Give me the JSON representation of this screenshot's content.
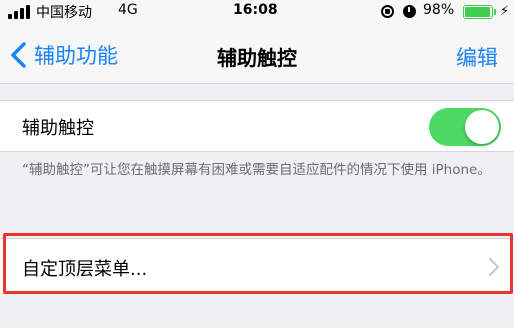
{
  "status_bar": {
    "carrier": "中国移动",
    "network": "4G",
    "time": "16:08",
    "battery_percent": "98%",
    "battery_level": 0.98,
    "icons": [
      "signal-bars-icon",
      "orientation-lock-icon",
      "alarm-icon",
      "battery-icon",
      "charging-bolt-icon"
    ]
  },
  "nav": {
    "back_label": "辅助功能",
    "title": "辅助触控",
    "edit_label": "编辑"
  },
  "assistive_touch": {
    "label": "辅助触控",
    "enabled": true,
    "description": "“辅助触控”可让您在触摸屏幕有困难或需要自适应配件的情况下使用 iPhone。"
  },
  "menu": {
    "customize_label": "自定顶层菜单..."
  },
  "colors": {
    "accent": "#1a82fb",
    "toggle_on": "#4cd964",
    "highlight": "#e8362f",
    "battery": "#3ecf4f"
  }
}
